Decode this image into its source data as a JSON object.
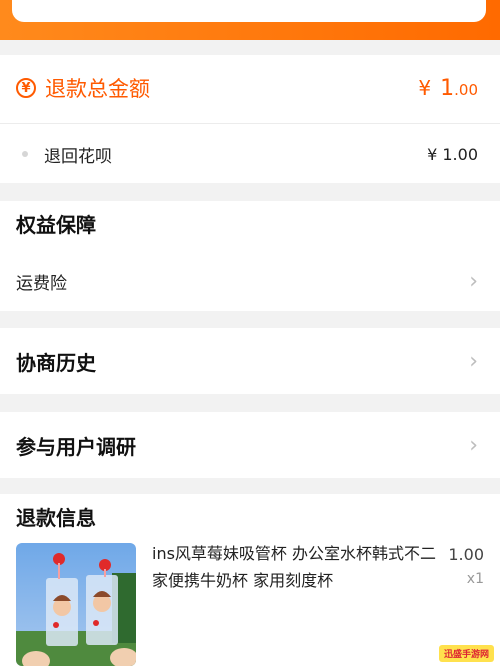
{
  "refund_total": {
    "icon": "yen-circle-icon",
    "title": "退款总金额",
    "currency": "¥",
    "amount_int": "1",
    "amount_dec": ".00"
  },
  "refund_method": {
    "label": "退回花呗",
    "amount": "¥ 1.00"
  },
  "benefits": {
    "title": "权益保障",
    "item_label": "运费险"
  },
  "negotiation_history": {
    "title": "协商历史"
  },
  "user_survey": {
    "title": "参与用户调研"
  },
  "refund_info": {
    "title": "退款信息",
    "product": {
      "name": "ins风草莓妹吸管杯 办公室水杯韩式不二家便携牛奶杯 家用刻度杯",
      "price": "1.00",
      "quantity": "x1"
    }
  },
  "watermark_text": "迅盛手游网",
  "colors": {
    "accent": "#ff5a00",
    "banner": "#ff7a12",
    "background": "#f2f2f2"
  },
  "icons": {
    "chevron": "chevron-right-icon",
    "bullet": "dot-icon"
  }
}
